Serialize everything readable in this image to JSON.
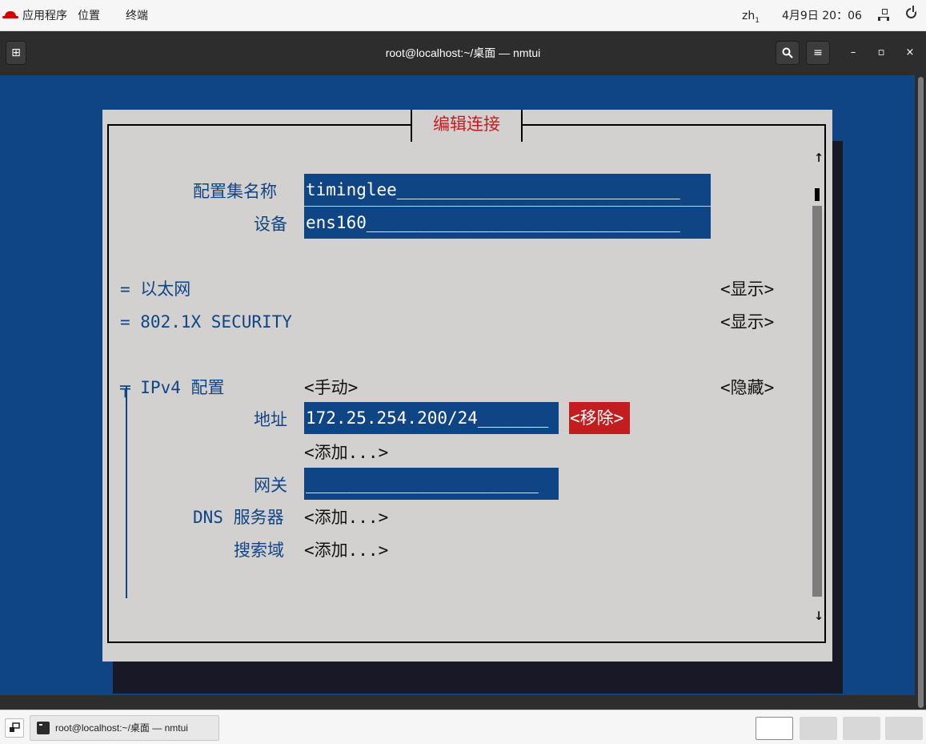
{
  "topbar": {
    "applications": "应用程序",
    "places": "位置",
    "app_name": "终端",
    "input_method": "zh",
    "input_method_sub": "1",
    "datetime": "4月9日 20：06"
  },
  "window": {
    "title": "root@localhost:~/桌面 — nmtui",
    "new_tab_glyph": "⊞",
    "search_glyph": "🔍",
    "menu_glyph": "≡",
    "minimize_glyph": "–",
    "maximize_glyph": "▫",
    "close_glyph": "×"
  },
  "dialog": {
    "title": "编辑连接",
    "profile_name_label": "配置集名称",
    "profile_name_value": "timinglee____________________________",
    "device_label": "设备",
    "device_value": "ens160_______________________________",
    "ethernet_label": "= 以太网",
    "ethernet_toggle": "<显示>",
    "security_label": "= 802.1X SECURITY",
    "security_toggle": "<显示>",
    "ipv4_label": "╤ IPv4 配置",
    "ipv4_mode": "<手动>",
    "ipv4_toggle": "<隐藏>",
    "address_label": "地址",
    "address_value": "172.25.254.200/24_______",
    "remove_button": "<移除>",
    "add_address": "<添加...>",
    "gateway_label": "网关",
    "gateway_value": "_______________________",
    "dns_label": "DNS 服务器",
    "dns_add": "<添加...>",
    "search_domain_label": "搜索域",
    "search_domain_add": "<添加...>",
    "scroll_up": "↑",
    "scroll_down": "↓"
  },
  "taskbar": {
    "task_label": "root@localhost:~/桌面 — nmtui"
  },
  "colors": {
    "terminal_bg": "#0f4584",
    "dialog_bg": "#d3d1d0",
    "accent_red": "#c41d20"
  }
}
